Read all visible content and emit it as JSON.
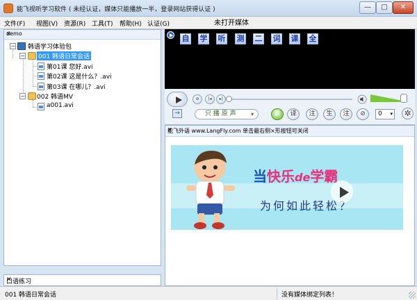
{
  "window": {
    "title": "能飞视听学习软件 ( 未经认证，媒体只能播放一半，登录网站获得认证 )",
    "minimize": "—",
    "maximize": "□",
    "close": "✕"
  },
  "menu": {
    "items": [
      "文件(F)",
      "视图(V)",
      "资源(R)",
      "工具(T)",
      "帮助(H)",
      "认证(G)"
    ],
    "media_status": "未打开媒体"
  },
  "tree": {
    "pane_title": "demo",
    "close_label": "✕",
    "root": "韩语学习体验包",
    "folder1": "001 韩语日常会话",
    "lessons": [
      "第01课 您好.avi",
      "第02课 这是什么？.avi",
      "第03课 在哪儿？.avi"
    ],
    "folder2": "002 韩语MV",
    "mv_file": "a001.avi",
    "expanded": "−"
  },
  "practice": {
    "title": "口语练习",
    "close_label": "✕"
  },
  "video": {
    "chars": [
      "自",
      "学",
      "听",
      "测",
      "二",
      "词",
      "课",
      "全"
    ]
  },
  "controls": {
    "stop_label": "⊘",
    "prev_label": "|◂",
    "next_label": "▸|",
    "arrow_label": "→",
    "mode": "只 播 原 声",
    "mode_caret": "▾",
    "round_buttons": [
      "录",
      "译",
      "注",
      "生",
      "注",
      "⊘"
    ],
    "number": "0",
    "number_caret": "▾",
    "gear": "✲",
    "volume": 0.85,
    "progress": 0.0
  },
  "browser": {
    "header": "能飞外语 www.LangFly.com 单击最右侧×形按钮可关闭",
    "close_label": "✕",
    "banner": {
      "slogan_a": "当",
      "slogan_b": "快乐",
      "slogan_c": "de",
      "slogan_d": "学霸",
      "sub": "为何如此轻松？"
    }
  },
  "status": {
    "left": "001 韩语日常会话",
    "right": "没有媒体绑定列表！"
  },
  "colors": {
    "selection": "#3399ff",
    "accent_green": "#6fbf3b",
    "banner_bg": "#a7e6f2",
    "slogan_pink": "#e8317c",
    "slogan_blue": "#1a52b4"
  }
}
